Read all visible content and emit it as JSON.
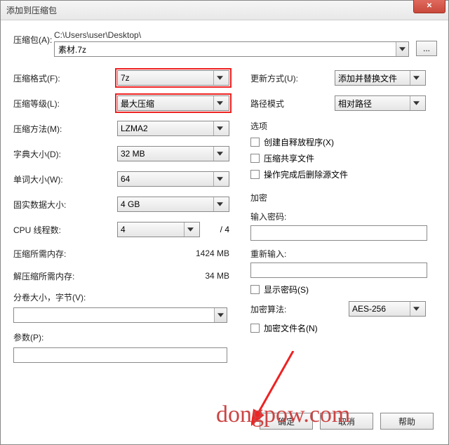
{
  "title": "添加到压缩包",
  "archive": {
    "label": "压缩包(A):",
    "path": "C:\\Users\\user\\Desktop\\",
    "filename": "素材.7z",
    "browse": "..."
  },
  "left": {
    "format_label": "压缩格式(F):",
    "format_value": "7z",
    "level_label": "压缩等级(L):",
    "level_value": "最大压缩",
    "method_label": "压缩方法(M):",
    "method_value": "LZMA2",
    "dict_label": "字典大小(D):",
    "dict_value": "32 MB",
    "word_label": "单词大小(W):",
    "word_value": "64",
    "solid_label": "固实数据大小:",
    "solid_value": "4 GB",
    "cpu_label": "CPU 线程数:",
    "cpu_value": "4",
    "cpu_total": "/ 4",
    "mem_compress_label": "压缩所需内存:",
    "mem_compress_value": "1424 MB",
    "mem_decompress_label": "解压缩所需内存:",
    "mem_decompress_value": "34 MB",
    "split_label": "分卷大小，字节(V):",
    "params_label": "参数(P):"
  },
  "right": {
    "update_label": "更新方式(U):",
    "update_value": "添加并替换文件",
    "path_label": "路径模式",
    "path_value": "相对路径",
    "options_title": "选项",
    "opt_sfx": "创建自释放程序(X)",
    "opt_share": "压缩共享文件",
    "opt_delete": "操作完成后删除源文件",
    "encrypt_title": "加密",
    "pw_label": "输入密码:",
    "pw_confirm_label": "重新输入:",
    "show_pw": "显示密码(S)",
    "algo_label": "加密算法:",
    "algo_value": "AES-256",
    "encrypt_names": "加密文件名(N)"
  },
  "buttons": {
    "ok": "确定",
    "cancel": "取消",
    "help": "帮助"
  },
  "watermark": "dongpow.com"
}
